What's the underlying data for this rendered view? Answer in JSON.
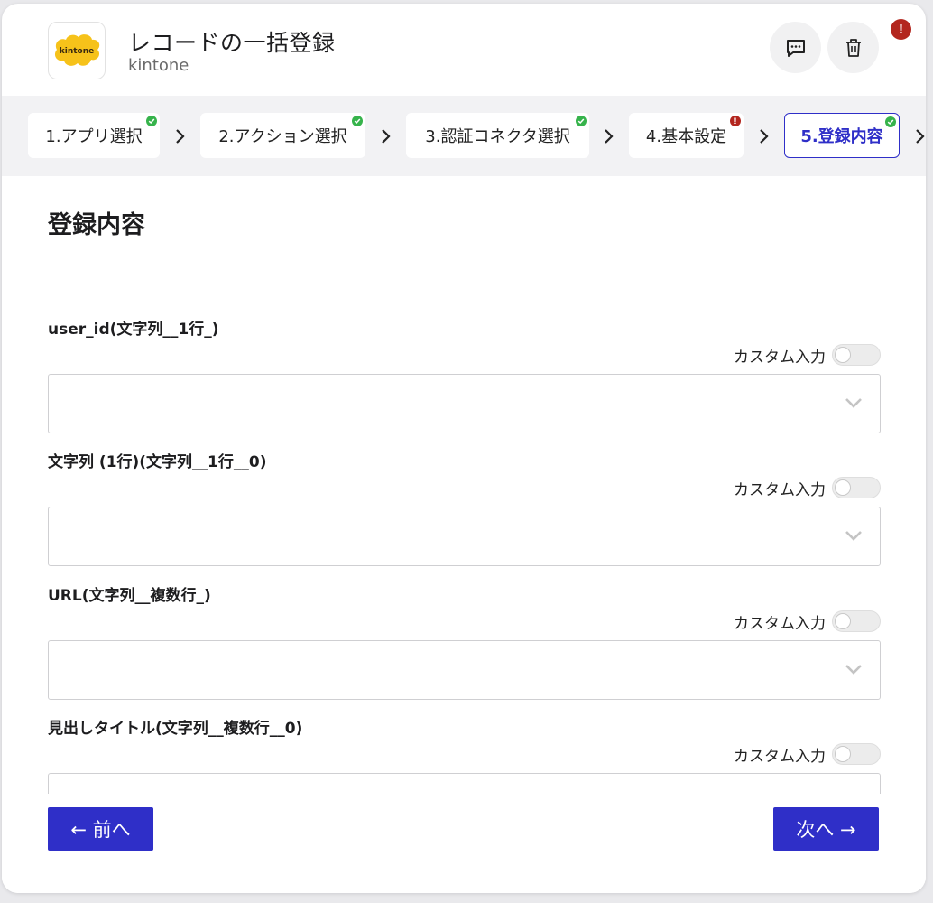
{
  "header": {
    "title": "レコードの一括登録",
    "subtitle": "kintone",
    "logo_text": "kintone",
    "logo_color": "#f6c21a",
    "alert": "!"
  },
  "steps": [
    {
      "label": "1.アプリ選択",
      "status": "complete"
    },
    {
      "label": "2.アクション選択",
      "status": "complete"
    },
    {
      "label": "3.認証コネクタ選択",
      "status": "complete"
    },
    {
      "label": "4.基本設定",
      "status": "error",
      "badge": "!"
    },
    {
      "label": "5.登録内容",
      "status": "complete",
      "active": true
    }
  ],
  "main": {
    "section_title": "登録内容",
    "custom_label": "カスタム入力",
    "fields": [
      {
        "label": "user_id(文字列__1行_)",
        "value": ""
      },
      {
        "label": "文字列 (1行)(文字列__1行__0)",
        "value": ""
      },
      {
        "label": "URL(文字列__複数行_)",
        "value": ""
      },
      {
        "label": "見出しタイトル(文字列__複数行__0)",
        "value": ""
      }
    ]
  },
  "footer": {
    "prev_label": "← 前へ",
    "next_label": "次へ →"
  },
  "colors": {
    "accent": "#2f2fc8",
    "success": "#36b34b",
    "error": "#b3261e"
  }
}
